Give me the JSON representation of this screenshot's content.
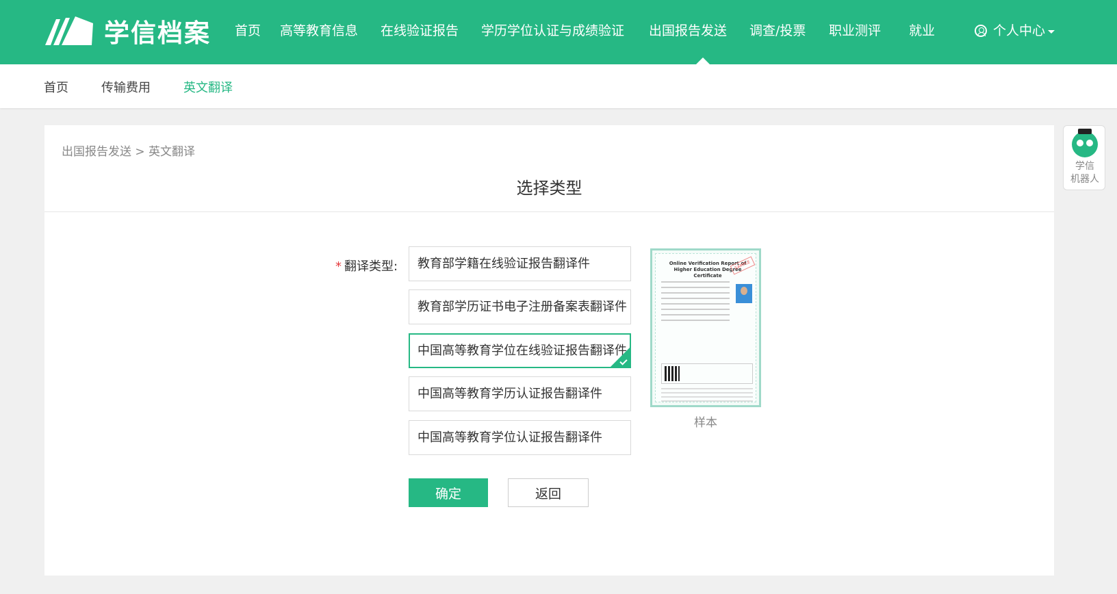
{
  "header": {
    "logo_text": "学信档案",
    "nav": [
      {
        "label": "首页"
      },
      {
        "label": "高等教育信息"
      },
      {
        "label": "在线验证报告"
      },
      {
        "label": "学历学位认证与成绩验证"
      },
      {
        "label": "出国报告发送"
      },
      {
        "label": "调查/投票"
      },
      {
        "label": "职业测评"
      },
      {
        "label": "就业"
      }
    ],
    "user_menu": "个人中心",
    "brand_color": "#26b884"
  },
  "subnav": {
    "items": [
      {
        "label": "首页"
      },
      {
        "label": "传输费用"
      },
      {
        "label": "英文翻译"
      }
    ]
  },
  "main": {
    "breadcrumb": "出国报告发送 > 英文翻译",
    "title": "选择类型",
    "field_required": "*",
    "field_label": "翻译类型:",
    "options": [
      {
        "label": "教育部学籍在线验证报告翻译件"
      },
      {
        "label": "教育部学历证书电子注册备案表翻译件"
      },
      {
        "label": "中国高等教育学位在线验证报告翻译件"
      },
      {
        "label": "中国高等教育学历认证报告翻译件"
      },
      {
        "label": "中国高等教育学位认证报告翻译件"
      }
    ],
    "selected_option": "中国高等教育学位在线验证报告翻译件",
    "sample": {
      "title": "Online Verification Report of Higher Education Degree Certificate",
      "stamp": "SAMPLE",
      "caption": "样本"
    },
    "confirm_label": "确定",
    "back_label": "返回"
  },
  "robot": {
    "label": "学信\n机器人"
  }
}
